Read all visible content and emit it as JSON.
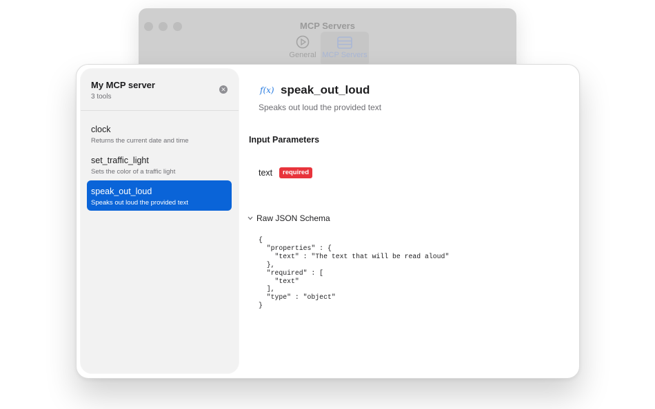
{
  "background_window": {
    "title": "MCP Servers",
    "tabs": [
      {
        "label": "General",
        "icon": "general-icon"
      },
      {
        "label": "MCP Servers",
        "icon": "servers-icon"
      }
    ]
  },
  "sidebar": {
    "server_name": "My MCP server",
    "tool_count": "3 tools",
    "close_icon": "close-circle-icon",
    "tools": [
      {
        "name": "clock",
        "description": "Returns the current date and time"
      },
      {
        "name": "set_traffic_light",
        "description": "Sets the color of a traffic light"
      },
      {
        "name": "speak_out_loud",
        "description": "Speaks out loud the provided text"
      }
    ],
    "selected_index": 2
  },
  "detail": {
    "icon_label": "f(x)",
    "tool_name": "speak_out_loud",
    "tool_description": "Speaks out loud the provided text",
    "input_parameters_heading": "Input Parameters",
    "parameter": {
      "name": "text",
      "badge": "required"
    },
    "raw_schema_label": "Raw JSON Schema",
    "raw_schema": "{\n  \"properties\" : {\n    \"text\" : \"The text that will be read aloud\"\n  },\n  \"required\" : [\n    \"text\"\n  ],\n  \"type\" : \"object\"\n}"
  },
  "colors": {
    "accent": "#0a64d8",
    "required_badge": "#e8343c",
    "function_icon": "#2a7de1"
  }
}
